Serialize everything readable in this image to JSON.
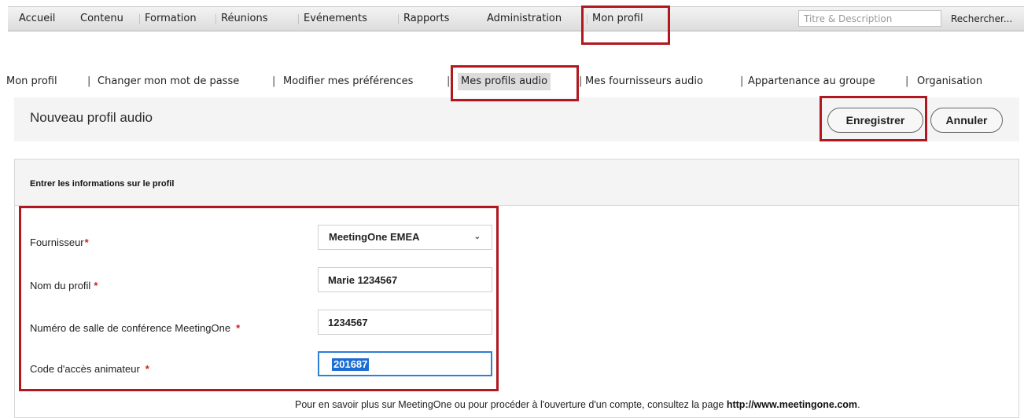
{
  "nav": {
    "items": [
      "Accueil",
      "Contenu",
      "Formation",
      "Réunions",
      "Evénements",
      "Rapports",
      "Administration",
      "Mon profil"
    ],
    "search_placeholder": "Titre & Description",
    "search_button": "Rechercher..."
  },
  "subnav": {
    "items": [
      "Mon profil",
      "Changer mon mot de passe",
      "Modifier mes préférences",
      "Mes profils audio",
      "Mes fournisseurs audio",
      "Appartenance au groupe",
      "Organisation"
    ],
    "separator": "|",
    "active": "Mes profils audio"
  },
  "page": {
    "title": "Nouveau profil audio",
    "save_label": "Enregistrer",
    "cancel_label": "Annuler"
  },
  "form": {
    "section_title": "Entrer les informations sur le profil",
    "required_marker": "*",
    "provider": {
      "label": "Fournisseur",
      "value": "MeetingOne EMEA"
    },
    "profile_name": {
      "label": "Nom du profil",
      "value": "Marie 1234567"
    },
    "room_number": {
      "label": "Numéro de salle de conférence MeetingOne",
      "value": "1234567"
    },
    "host_code": {
      "label": "Code d'accès animateur",
      "value": "201687"
    }
  },
  "footer": {
    "text": "Pour en savoir plus sur MeetingOne ou pour procéder à l'ouverture d'un compte, consultez la page ",
    "link": "http://www.meetingone.com",
    "end": "."
  },
  "colors": {
    "annotation": "#b0171f",
    "required": "#cc1f1f",
    "selection": "#1b6dd4",
    "focus": "#2f7fd6"
  }
}
